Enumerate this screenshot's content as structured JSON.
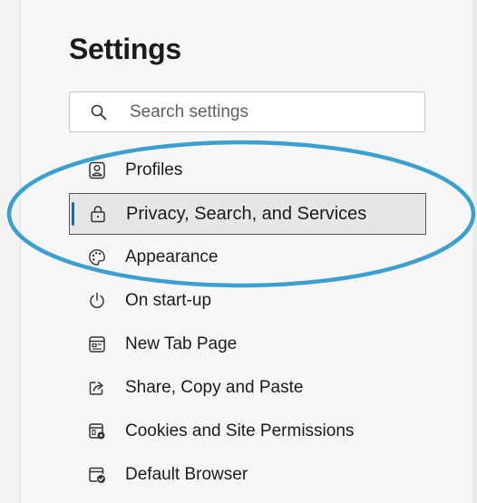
{
  "page": {
    "title": "Settings"
  },
  "search": {
    "placeholder": "Search settings"
  },
  "nav": {
    "items": [
      {
        "label": "Profiles",
        "icon": "profile-icon"
      },
      {
        "label": "Privacy, Search, and Services",
        "icon": "lock-icon",
        "selected": true
      },
      {
        "label": "Appearance",
        "icon": "palette-icon"
      },
      {
        "label": "On start-up",
        "icon": "power-icon"
      },
      {
        "label": "New Tab Page",
        "icon": "new-tab-icon"
      },
      {
        "label": "Share, Copy and Paste",
        "icon": "share-icon"
      },
      {
        "label": "Cookies and Site Permissions",
        "icon": "cookies-permissions-icon"
      },
      {
        "label": "Default Browser",
        "icon": "default-browser-icon"
      }
    ]
  },
  "colors": {
    "accent": "#0f6cbd",
    "highlight_ellipse": "#3aa0cf",
    "selected_background": "#e6e6e6"
  }
}
